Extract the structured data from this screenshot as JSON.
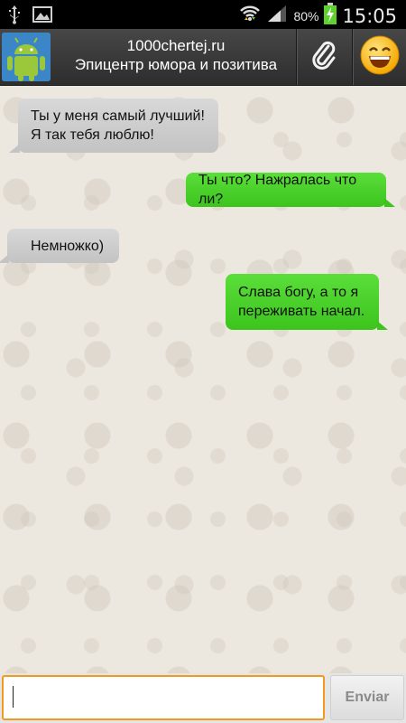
{
  "status_bar": {
    "battery_percent": "80%",
    "time": "15:05",
    "icons": [
      "usb-icon",
      "image-icon",
      "wifi-icon",
      "signal-icon",
      "battery-charging-icon"
    ]
  },
  "header": {
    "title": "1000chertej.ru",
    "subtitle": "Эпицентр юмора и позитива",
    "avatar_icon": "android-icon",
    "attach_icon": "paperclip-icon",
    "emoji_icon": "smiley-icon"
  },
  "messages": [
    {
      "direction": "in",
      "text_lines": [
        "Ты у меня самый лучший!",
        "Я так тебя люблю!"
      ]
    },
    {
      "direction": "out",
      "text_lines": [
        "Ты что? Нажралась что ли?"
      ]
    },
    {
      "direction": "in",
      "text_lines": [
        "Немножко)"
      ]
    },
    {
      "direction": "out",
      "text_lines": [
        "Слава богу, а то я",
        "переживать начал."
      ]
    }
  ],
  "input": {
    "value": "",
    "placeholder": ""
  },
  "send_button": {
    "label": "Enviar"
  },
  "colors": {
    "incoming_bubble": "#cfcfcf",
    "outgoing_bubble": "#4fd42e",
    "input_focus_border": "#f29a1f",
    "header_bg": "#3a3a3a"
  }
}
